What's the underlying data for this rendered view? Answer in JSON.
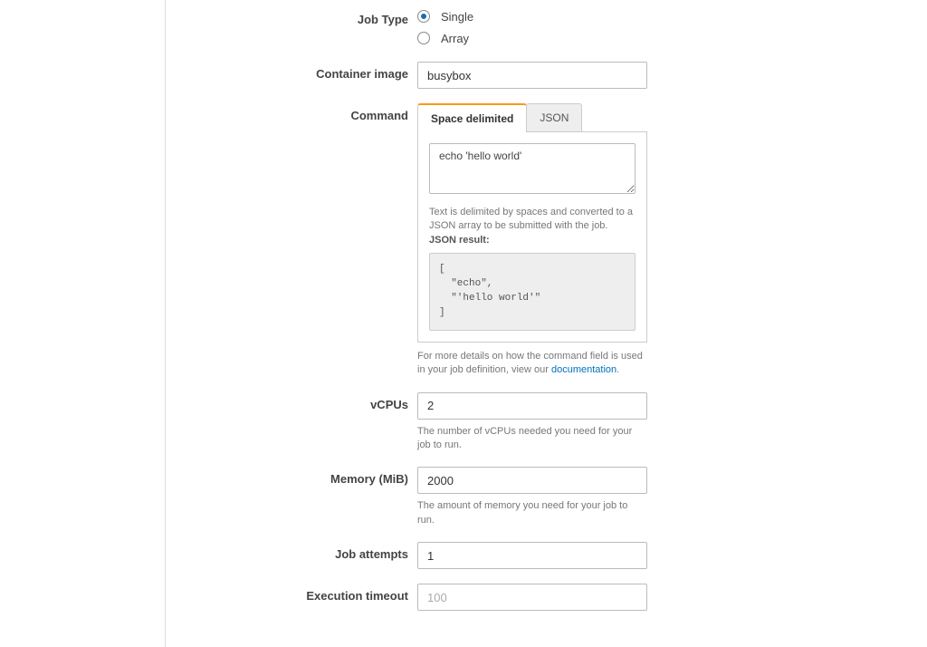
{
  "jobType": {
    "label": "Job Type",
    "options": {
      "single": "Single",
      "array": "Array"
    }
  },
  "containerImage": {
    "label": "Container image",
    "value": "busybox"
  },
  "command": {
    "label": "Command",
    "tabs": {
      "space": "Space delimited",
      "json": "JSON"
    },
    "value": "echo 'hello world'",
    "help": "Text is delimited by spaces and converted to a JSON array to be submitted with the job.",
    "jsonResultLabel": "JSON result:",
    "jsonResult": "[\n  \"echo\",\n  \"'hello world'\"\n]",
    "footerPrefix": "For more details on how the command field is used in your job definition, view our ",
    "footerLink": "documentation"
  },
  "vcpus": {
    "label": "vCPUs",
    "value": "2",
    "help": "The number of vCPUs needed you need for your job to run."
  },
  "memory": {
    "label": "Memory (MiB)",
    "value": "2000",
    "help": "The amount of memory you need for your job to run."
  },
  "jobAttempts": {
    "label": "Job attempts",
    "value": "1"
  },
  "executionTimeout": {
    "label": "Execution timeout",
    "placeholder": "100"
  }
}
